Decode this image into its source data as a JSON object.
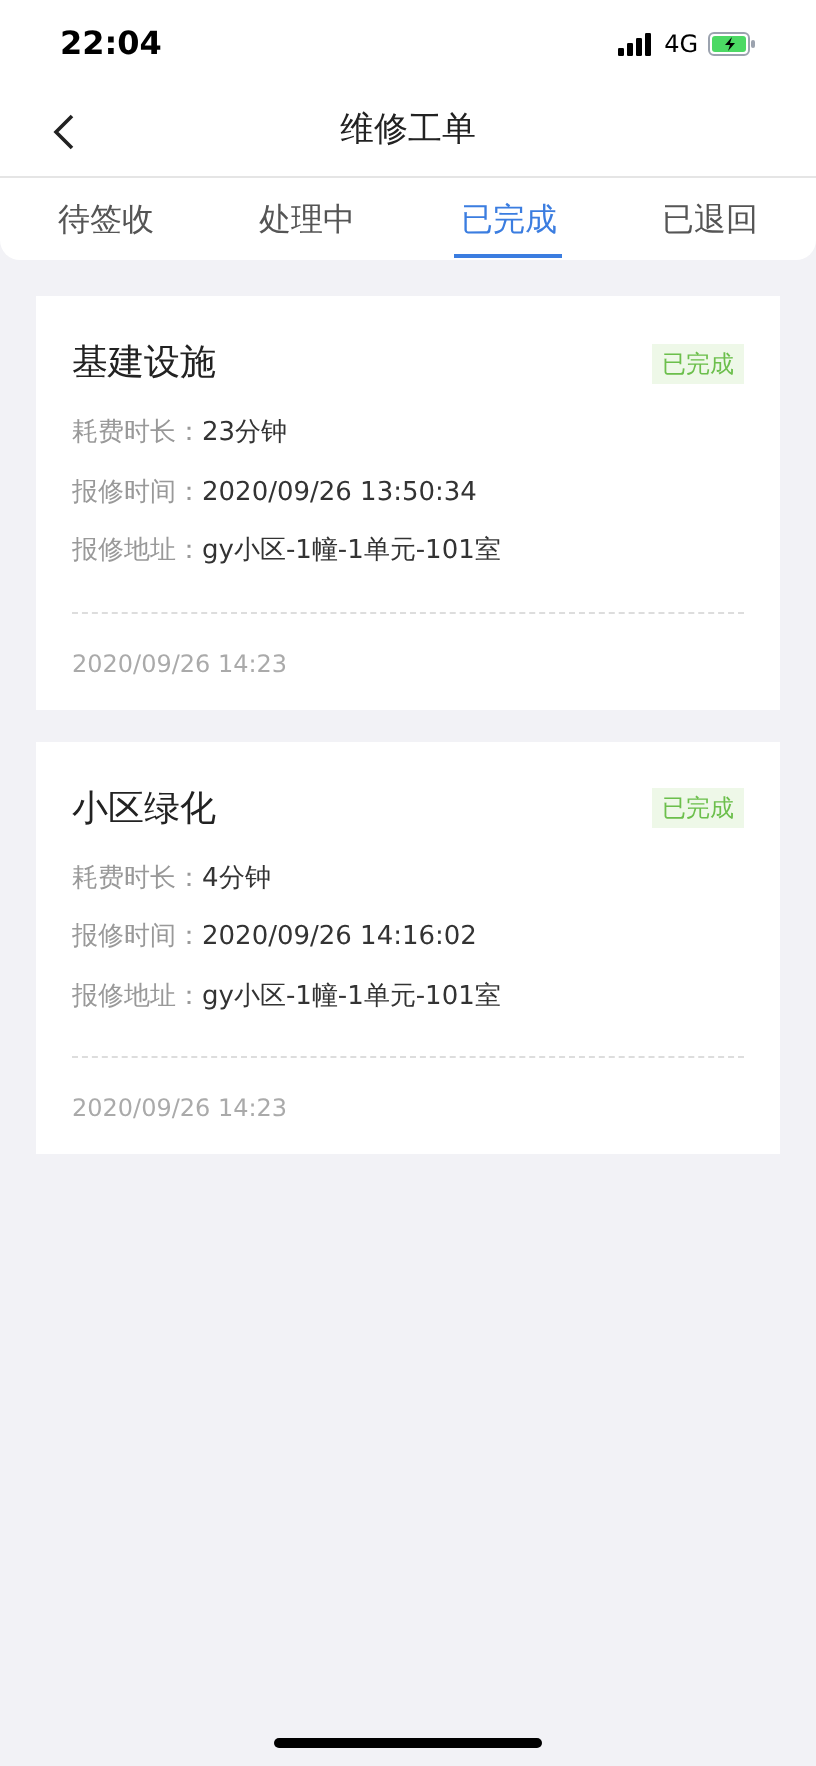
{
  "status_bar": {
    "time": "22:04",
    "network": "4G"
  },
  "nav": {
    "title": "维修工单"
  },
  "tabs": [
    {
      "label": "待签收",
      "selected": false
    },
    {
      "label": "处理中",
      "selected": false
    },
    {
      "label": "已完成",
      "selected": true
    },
    {
      "label": "已退回",
      "selected": false
    }
  ],
  "orders": [
    {
      "title": "基建设施",
      "status": "已完成",
      "fields": [
        {
          "label": "耗费时长：",
          "value": "23分钟"
        },
        {
          "label": "报修时间：",
          "value": "2020/09/26 13:50:34"
        },
        {
          "label": "报修地址：",
          "value": "gy小区-1幢-1单元-101室"
        }
      ],
      "footer": "2020/09/26 14:23"
    },
    {
      "title": "小区绿化",
      "status": "已完成",
      "fields": [
        {
          "label": "耗费时长：",
          "value": "4分钟"
        },
        {
          "label": "报修时间：",
          "value": "2020/09/26 14:16:02"
        },
        {
          "label": "报修地址：",
          "value": "gy小区-1幢-1单元-101室"
        }
      ],
      "footer": "2020/09/26 14:23"
    }
  ]
}
